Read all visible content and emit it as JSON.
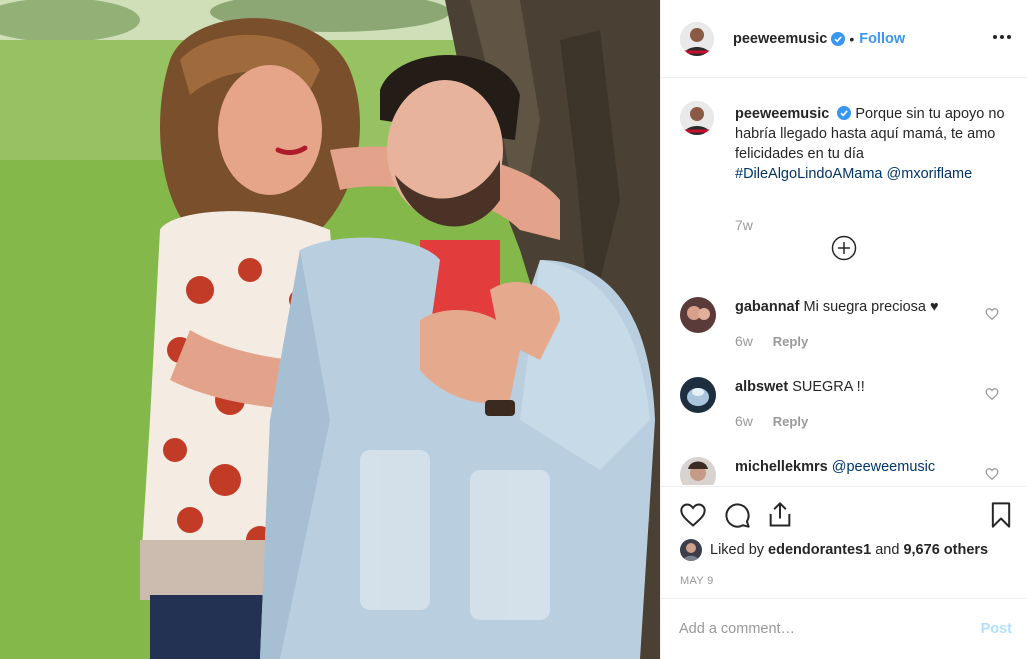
{
  "post": {
    "username": "peeweemusic",
    "separator": "•",
    "follow_label": "Follow",
    "more_icon": "more-options-icon"
  },
  "caption": {
    "username": "peeweemusic",
    "text": "Porque sin tu apoyo no habría llegado hasta aquí mamá, te amo felicidades en tu día ",
    "hashtag": "#DileAlgoLindoAMama",
    "mention": "@mxoriflame",
    "time": "7w"
  },
  "comments": [
    {
      "username": "gabannaf",
      "text": "Mi suegra preciosa ♥",
      "time": "6w",
      "reply": "Reply"
    },
    {
      "username": "albswet",
      "text": "SUEGRA !!",
      "time": "6w",
      "reply": "Reply"
    },
    {
      "username": "michellekmrs",
      "text": "@peeweemusic",
      "time": "",
      "reply": ""
    }
  ],
  "actions": {
    "like_icon": "heart-icon",
    "comment_icon": "comment-bubble-icon",
    "share_icon": "share-icon",
    "save_icon": "bookmark-icon"
  },
  "likes": {
    "prefix": "Liked by ",
    "user": "edendorantes1",
    "middle": " and ",
    "count": "9,676 others"
  },
  "date": "MAY 9",
  "add_comment": {
    "placeholder": "Add a comment…",
    "post_label": "Post"
  },
  "colors": {
    "link": "#003569",
    "follow": "#3897f0",
    "post_disabled": "#b2dffc",
    "muted": "#999999"
  }
}
